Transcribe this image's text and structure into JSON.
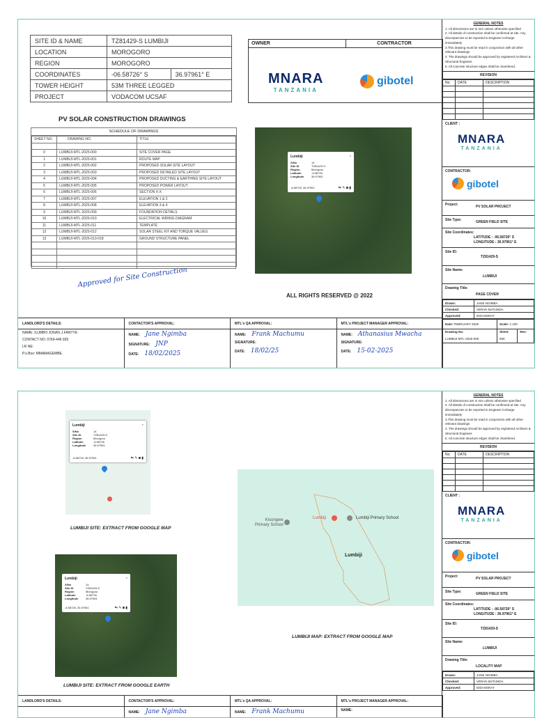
{
  "site_info": {
    "rows": [
      {
        "label": "SITE ID & NAME",
        "value": "TZ81429-S LUMBIJI"
      },
      {
        "label": "LOCATION",
        "value": "MOROGORO"
      },
      {
        "label": "REGION",
        "value": "MOROGORO"
      },
      {
        "label": "COORDINATES",
        "value": "-06.58726° S",
        "value2": "36.97961° E"
      },
      {
        "label": "TOWER HEIGHT",
        "value": "53M THREE LEGGED"
      },
      {
        "label": "PROJECT",
        "value": "VODACOM UCSAF"
      }
    ]
  },
  "owner_label": "OWNER",
  "contractor_label": "CONTRACTOR",
  "logos": {
    "monara_m": "M",
    "monara_rest": "NARA",
    "monara_sub": "TANZANIA",
    "gibotel": "gibotel"
  },
  "title": "PV SOLAR  CONSTRUCTION DRAWINGS",
  "schedule": {
    "caption": "SCHEDULE OF DRAWINGS",
    "headers": [
      "SHEET NO.",
      "DRAWING NO.",
      "TITLE"
    ],
    "rows": [
      [
        "0",
        "LUMBIJI-MTL-2025-000",
        "SITE COVER PAGE"
      ],
      [
        "1",
        "LUMBIJI-MTL-2025-001",
        "ROUTE MAP"
      ],
      [
        "2",
        "LUMBIJI-MTL-2025-002",
        "PROPOSED SOLAR SITE LAYOUT"
      ],
      [
        "3",
        "LUMBIJI-MTL-2025-003",
        "PROPOSED DETAILED SITE LAYOUT"
      ],
      [
        "4",
        "LUMBIJI-MTL-2025-004",
        "PROPOSED DUCTING & EARTHING SITE LAYOUT"
      ],
      [
        "5",
        "LUMBIJI-MTL-2025-005",
        "PROPOSED POWER LAYOUT"
      ],
      [
        "6",
        "LUMBIJI-MTL-2025-006",
        "SECTION X-X"
      ],
      [
        "7",
        "LUMBIJI-MTL-2025-007",
        "ELEVATION 1 & 2"
      ],
      [
        "8",
        "LUMBIJI-MTL-2025-008",
        "ELEVATION 3 & 4"
      ],
      [
        "9",
        "LUMBIJI-MTL-2025-009",
        "FOUNDATION DETAILS"
      ],
      [
        "10",
        "LUMBIJI-MTL-2025-010",
        "ELECTRICAL WIRING DIAGRAM"
      ],
      [
        "11",
        "LUMBIJI-MTL-2025-011",
        "TEMPLATE"
      ],
      [
        "12",
        "LUMBIJI-MTL-2025-012",
        "SOLAR STEEL KIT AND TORQUE VALUES"
      ],
      [
        "13",
        "LUMBIJI-MTL-2025-013-018",
        "GROUND STRUCTURE PANEL"
      ]
    ]
  },
  "handwritten_note": "Approved for Site Construction",
  "rights": "ALL RIGHTS RESERVED @ 2022",
  "popup": {
    "title": "Lumbiji",
    "rows": [
      [
        "S/No",
        "14"
      ],
      [
        "Site ID",
        "TZ81429-S"
      ],
      [
        "Region",
        "Morogoro"
      ],
      [
        "Latitude",
        "-6.58726"
      ],
      [
        "Longitude",
        "36.97961"
      ]
    ],
    "coords": "-6.58726, 36.97961"
  },
  "map": {
    "kisongwe": "Kisongwe",
    "primary": "Primary School",
    "lumbiji_pin": "Lumbiji",
    "lumbiji_school": "Lumbiji Primary School",
    "area": "Lumbiji"
  },
  "captions": {
    "site_gmap": "LUMBIJI SITE: EXTRACT FROM GOOGLE MAP",
    "map_gmap": "LUMBIJI MAP: EXTRACT FROM GOOGLE MAP",
    "site_gearth": "LUMBIJI SITE: EXTRACT FROM GOOGLE EARTH"
  },
  "approval": {
    "landlord": "LANDLORD'S DETAILS:",
    "landlord_name": "NAME:  ILUMBO  JONAS J.FANTYE",
    "landlord_contact": "CONTACT NO:  0769-446 935",
    "landlord_lr": "LR NE:",
    "landlord_po": "P.o.Box:  MMAMAGEMBE.",
    "contractor": "CONTACTOR'S  APPROVAL:",
    "qa": "MTL's QA APPROVAL:",
    "pm": "MTL's  PROJECT MANAGER APPROVAL:",
    "name": "NAME:",
    "signature": "SIGNATURE:",
    "date": "DATE:",
    "c_name": "Jane Ngimba",
    "c_sig": "JNP",
    "c_date": "18/02/2025",
    "qa_name": "Frank Machumu",
    "qa_date": "18/02/25",
    "pm_name": "Athanasius Mwacha",
    "pm_date": "15-02-2025"
  },
  "title_block": {
    "notes_title": "GENERAL NOTES",
    "notes": [
      "1. All dimensions are in mm unless otherwise specified",
      "2. All details of construction shall be confirmed at site. Any discrepancies to be reported to Engineer incharge immediately",
      "3.This drawing must be read in conjunction with all other relevant drawings",
      "4. The drawings should be approved by registered Architect & Structural Engineer.",
      "5. All concrete structure edges shall be chamfered."
    ],
    "revision": "REVISION",
    "rev_headers": [
      "No:",
      "DATE",
      "DESCRIPTION"
    ],
    "client": "CLIENT :",
    "contractor": "CONTRACTOR:",
    "project_label": "Project:",
    "project": "PV SOLAR PROJECT",
    "site_type_label": "Site Type:",
    "site_type": "GREEN FIELD SITE",
    "coords_label": "Site Coordinates:",
    "lat": "LATITUDE  :  -06.58726° S",
    "lon": "LONGITUDE : 36.97961° E",
    "site_id_label": "Site ID:",
    "site_id": "TZ81429-S",
    "site_name_label": "Site Name:",
    "site_name": "LUMBIJI",
    "drawing_title_label": "Drawing Title:",
    "drawn": "Drawn:",
    "drawn_v": "JANE NGIMBA",
    "checked": "Checked:",
    "checked_v": "VERAN MATUNDA",
    "approved": "Approved:",
    "approved_v": "IDDI MSRAY",
    "date_label": "Date:",
    "date_v": "FEBRUARY 2025",
    "scale_label": "Scale:",
    "scale_v": "1:100",
    "drawing_no_label": "Drawing No:",
    "sheet_label": "Sheet:",
    "rev_label": "Rev:",
    "sheets": [
      {
        "title": "PAGE COVER",
        "drawing_no": "LUMBIJI-MTL-2025-000",
        "sheet": "000"
      },
      {
        "title": "LOCALITY MAP"
      }
    ]
  }
}
